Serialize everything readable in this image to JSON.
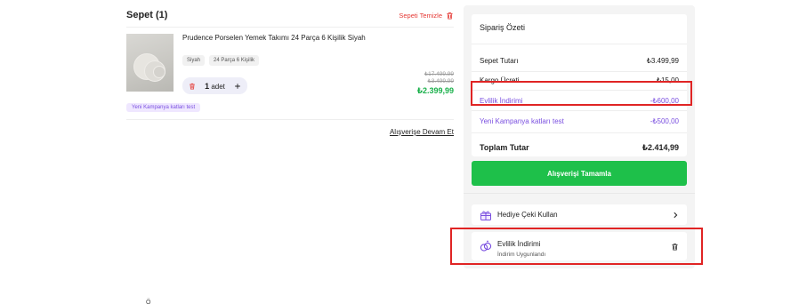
{
  "cart": {
    "title": "Sepet (1)",
    "clear_label": "Sepeti Temizle",
    "item": {
      "name": "Prudence Porselen Yemek Takımı 24 Parça 6 Kişilik Siyah",
      "tags": [
        "Siyah",
        "24 Parça 6 Kişilik"
      ],
      "quantity": "1",
      "quantity_unit": "adet",
      "price_old_1": "₺17.499,99",
      "price_old_2": "₺3.499,99",
      "price_current": "₺2.399,99"
    },
    "campaign_badge": "Yeni Kampanya katları test",
    "continue_label": "Alışverişe Devam Et",
    "bottom_partial": "Ö"
  },
  "summary": {
    "title": "Sipariş Özeti",
    "rows": [
      {
        "label": "Sepet Tutarı",
        "value": "₺3.499,99"
      },
      {
        "label": "Kargo Ücreti",
        "value": "₺15,00"
      },
      {
        "label": "Evlilik İndirimi",
        "value": "-₺600,00"
      },
      {
        "label": "Yeni Kampanya katları test",
        "value": "-₺500,00"
      }
    ],
    "total_label": "Toplam Tutar",
    "total_value": "₺2.414,99",
    "complete_button": "Alışverişi Tamamla"
  },
  "gift_card": {
    "label": "Hediye Çeki Kullan",
    "icon": "gift-box-icon"
  },
  "applied_discount": {
    "label": "Evlilik İndirimi",
    "status": "İndirim Uygunlandı",
    "icon": "rings-icon"
  },
  "colors": {
    "accent_purple": "#7a4fe0",
    "success_green": "#1ec04a",
    "danger_red": "#e53935",
    "highlight_red": "#e02424"
  }
}
